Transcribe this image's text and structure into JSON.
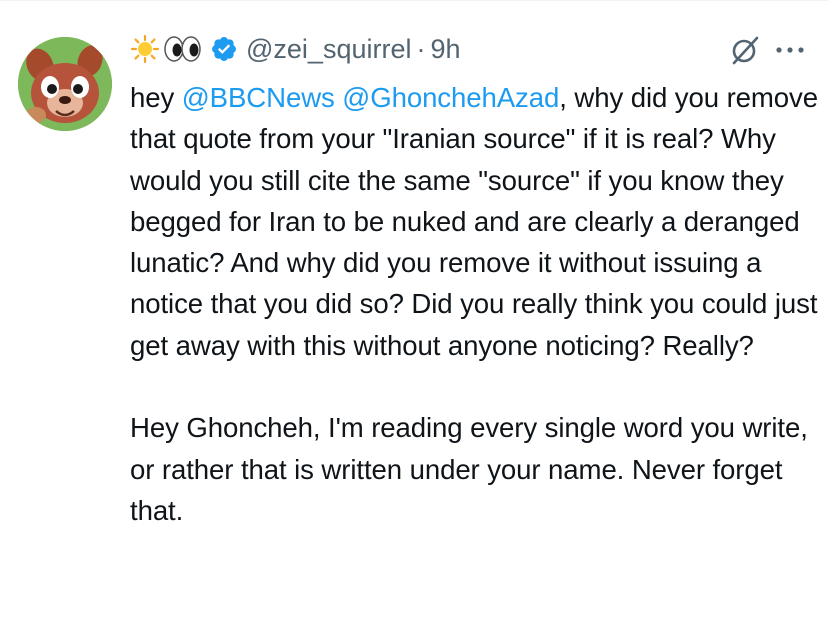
{
  "author": {
    "display_emoji": [
      "sun-emoji",
      "eyes-emoji"
    ],
    "handle": "@zei_squirrel",
    "separator": "·",
    "time": "9h",
    "verified_color": "#1d9bf0"
  },
  "tweet": {
    "intro": "hey ",
    "mention_1": "@BBCNews",
    "space": " ",
    "mention_2": "@GhonchehAzad",
    "paragraph_1_rest": ", why did you remove that quote from your \"Iranian source\" if it is real? Why would you still cite the same \"source\" if you know they begged for Iran to be nuked and are clearly a deranged lunatic? And why did you remove it without issuing a notice that you did so? Did you really think you could just get away with this without anyone noticing? Really?",
    "paragraph_2": "Hey Ghoncheh, I'm reading every single word you write, or rather that is written under your name. Never forget that."
  },
  "actions": {
    "grok_icon": "grok-icon",
    "more_icon": "more-icon"
  },
  "colors": {
    "text": "#0f1419",
    "secondary": "#536471",
    "link": "#1d9bf0"
  }
}
